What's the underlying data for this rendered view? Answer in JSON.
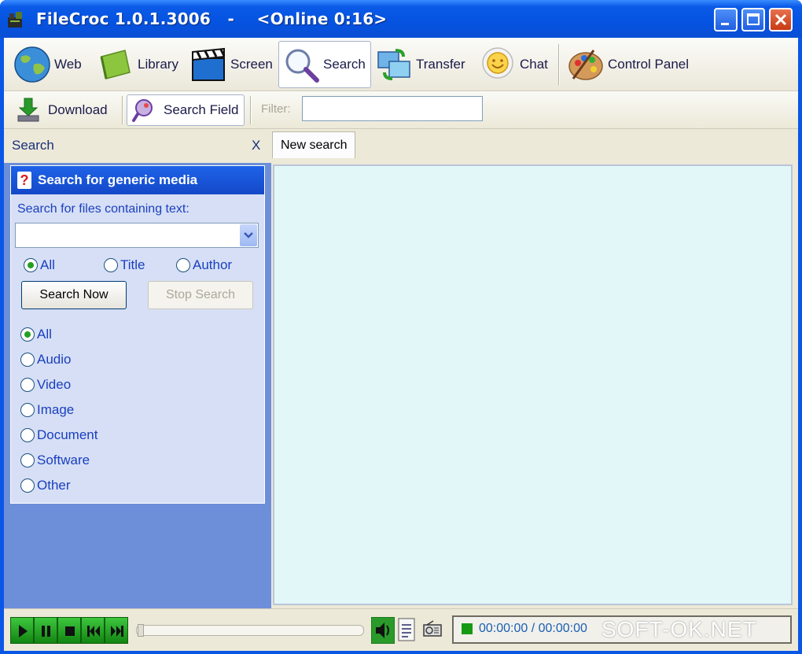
{
  "window": {
    "title": "FileCroc 1.0.1.3006   -    <Online 0:16>"
  },
  "toolbar": {
    "items": [
      {
        "label": "Web",
        "icon": "globe-icon"
      },
      {
        "label": "Library",
        "icon": "book-icon"
      },
      {
        "label": "Screen",
        "icon": "clapperboard-icon"
      },
      {
        "label": "Search",
        "icon": "magnifier-icon"
      },
      {
        "label": "Transfer",
        "icon": "transfer-icon"
      },
      {
        "label": "Chat",
        "icon": "smiley-icon"
      },
      {
        "label": "Control Panel",
        "icon": "palette-icon"
      }
    ],
    "active": "Search"
  },
  "subtoolbar": {
    "download_label": "Download",
    "search_field_label": "Search Field",
    "filter_label": "Filter:",
    "filter_value": ""
  },
  "left_panel": {
    "title": "Search",
    "close_label": "X",
    "box_title": "Search for generic media",
    "help_glyph": "?",
    "text_label": "Search for files containing text:",
    "search_text": "",
    "scope_options": [
      "All",
      "Title",
      "Author"
    ],
    "scope_selected": "All",
    "search_now_label": "Search Now",
    "stop_search_label": "Stop Search",
    "media_types": [
      "All",
      "Audio",
      "Video",
      "Image",
      "Document",
      "Software",
      "Other"
    ],
    "media_selected": "All"
  },
  "tabs": [
    {
      "label": "New search"
    }
  ],
  "player": {
    "time": "00:00:00 / 00:00:00",
    "progress": 0
  },
  "watermark": "SOFT-OK.NET",
  "colors": {
    "titlebar": "#0553e0",
    "panel_bg": "#6d8fd9",
    "search_box_bg": "#d6dff5",
    "content_bg": "#e2f8f8",
    "player_green": "#21a121"
  }
}
